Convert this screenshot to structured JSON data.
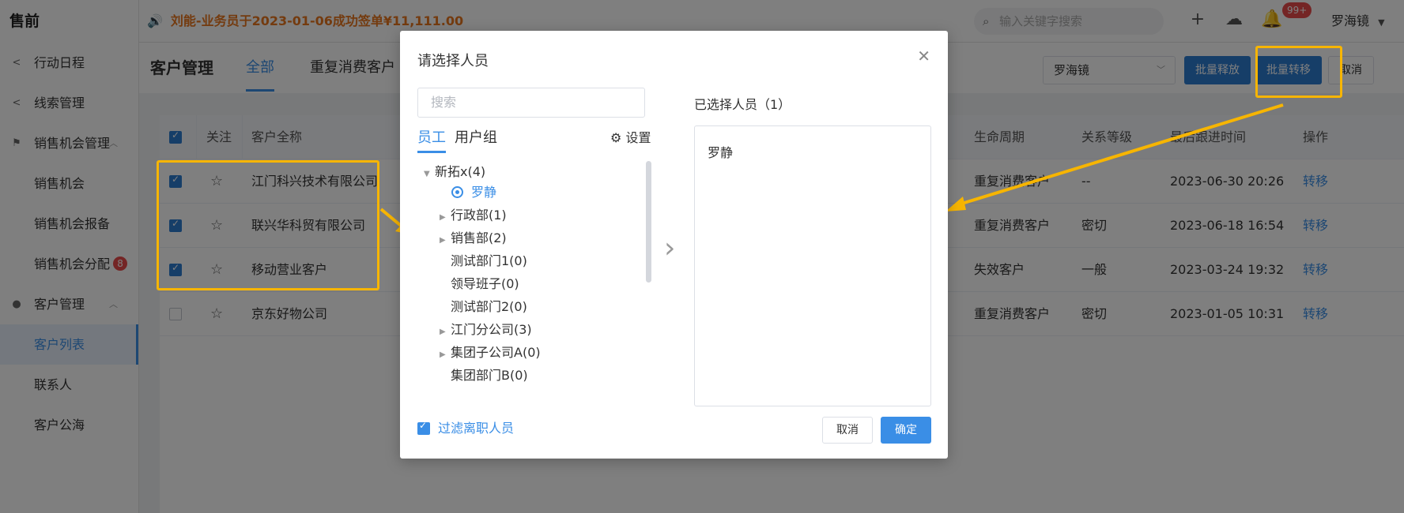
{
  "sidebar": {
    "brand": "售前",
    "items": [
      {
        "label": "行动日程",
        "icon": "share-icon"
      },
      {
        "label": "线索管理",
        "icon": "share-icon"
      },
      {
        "label": "销售机会管理",
        "icon": "flag-icon"
      },
      {
        "label": "销售机会"
      },
      {
        "label": "销售机会报备"
      },
      {
        "label": "销售机会分配",
        "badge": "8"
      },
      {
        "label": "客户管理",
        "icon": "user-icon"
      },
      {
        "label": "客户列表"
      },
      {
        "label": "联系人"
      },
      {
        "label": "客户公海"
      }
    ]
  },
  "topbar": {
    "notice": "刘能-业务员于2023-01-06成功签单¥11,111.00",
    "search_placeholder": "输入关键字搜索",
    "bell_badge": "99+",
    "user": "罗海镜"
  },
  "page": {
    "title": "客户管理",
    "tabs": [
      "全部",
      "重复消费客户"
    ],
    "owner_select": "罗海镜",
    "btn_batch_release": "批量释放",
    "btn_batch_transfer": "批量转移",
    "btn_cancel": "取消"
  },
  "table": {
    "headers": {
      "follow": "关注",
      "name": "客户全称",
      "lifecycle": "生命周期",
      "relation": "关系等级",
      "last_follow": "最后跟进时间",
      "action": "操作"
    },
    "rows": [
      {
        "checked": true,
        "name": "江门科兴技术有限公司",
        "lifecycle": "重复消费客户",
        "relation": "--",
        "time": "2023-06-30 20:26",
        "action": "转移"
      },
      {
        "checked": true,
        "name": "联兴华科贸有限公司",
        "lifecycle": "重复消费客户",
        "relation": "密切",
        "time": "2023-06-18 16:54",
        "action": "转移"
      },
      {
        "checked": true,
        "name": "移动营业客户",
        "lifecycle": "失效客户",
        "relation": "一般",
        "time": "2023-03-24 19:32",
        "action": "转移"
      },
      {
        "checked": false,
        "name": "京东好物公司",
        "lifecycle": "重复消费客户",
        "relation": "密切",
        "time": "2023-01-05 10:31",
        "action": "转移"
      }
    ]
  },
  "modal": {
    "title": "请选择人员",
    "search_placeholder": "搜索",
    "tab_staff": "员工",
    "tab_group": "用户组",
    "setting": "设置",
    "tree": [
      {
        "label": "新拓x(4)",
        "expanded": true
      },
      {
        "label": "罗静",
        "selected": true
      },
      {
        "label": "行政部(1)"
      },
      {
        "label": "销售部(2)"
      },
      {
        "label": "测试部门1(0)"
      },
      {
        "label": "领导班子(0)"
      },
      {
        "label": "测试部门2(0)"
      },
      {
        "label": "江门分公司(3)"
      },
      {
        "label": "集团子公司A(0)"
      },
      {
        "label": "集团部门B(0)"
      }
    ],
    "selected_label": "已选择人员（1）",
    "selected_items": [
      "罗静"
    ],
    "filter_label": "过滤离职人员",
    "btn_cancel": "取消",
    "btn_ok": "确定"
  },
  "colors": {
    "accent": "#3a8ee6",
    "highlight": "#f7b500",
    "notice": "#e8761e"
  }
}
